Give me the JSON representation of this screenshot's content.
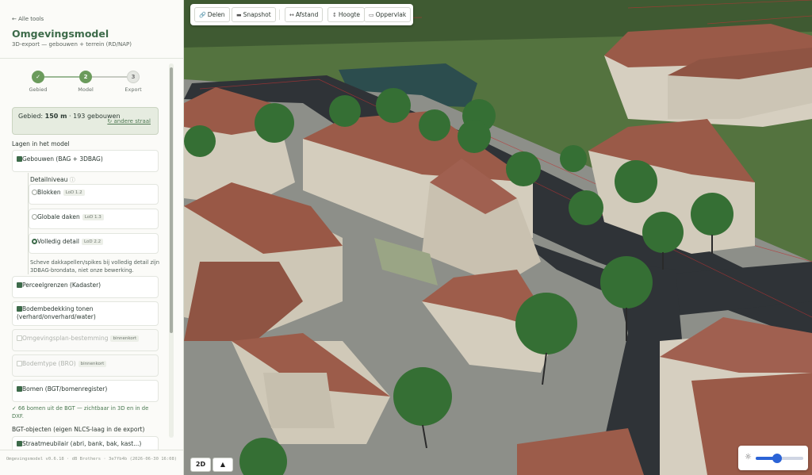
{
  "sidebar": {
    "back_link": "← Alle tools",
    "title": "Omgevingsmodel",
    "subtitle": "3D-export — gebouwen + terrein (RD/NAP)",
    "steps": [
      {
        "number": "✓",
        "label": "Gebied",
        "state": "done"
      },
      {
        "number": "2",
        "label": "Model",
        "state": "active"
      },
      {
        "number": "3",
        "label": "Export",
        "state": "todo"
      }
    ],
    "area": {
      "prefix": "Gebied: ",
      "size": "150 m",
      "count_text": " · 193 gebouwen",
      "change_link": "↻ andere straal"
    },
    "layers_heading": "Lagen in het model",
    "buildings": {
      "label": "Gebouwen (BAG + 3DBAG)",
      "checked": true
    },
    "detail": {
      "label": "Detailniveau",
      "info_icon": "ⓘ",
      "options": [
        {
          "label": "Blokken",
          "tag": "LoD 1.2",
          "selected": false
        },
        {
          "label": "Globale daken",
          "tag": "LoD 1.3",
          "selected": false
        },
        {
          "label": "Volledig detail",
          "tag": "LoD 2.2",
          "selected": true
        }
      ],
      "note": "Scheve dakkapellen/spikes bij volledig detail zijn 3DBAG-brondata, niet onze bewerking."
    },
    "parcels": {
      "label": "Perceelgrenzen (Kadaster)",
      "checked": true
    },
    "landcover": {
      "label": "Bodembedekking tonen (verhard/onverhard/water)",
      "checked": true
    },
    "zoning": {
      "label": "Omgevingsplan-bestemming",
      "tag": "binnenkort",
      "checked": false
    },
    "soil": {
      "label": "Bodemtype (BRO)",
      "tag": "binnenkort",
      "checked": false
    },
    "trees": {
      "label": "Bomen (BGT/bomenregister)",
      "checked": true
    },
    "trees_note": "✓ 66 bomen uit de BGT — zichtbaar in 3D en in de DXF.",
    "bgt_heading": "BGT-objecten (eigen NLCS-laag in de export)",
    "furniture": {
      "label": "Straatmeubilair (abri, bank, bak, kast...)",
      "checked": true
    },
    "footer": "Omgevingsmodel v0.6.18 · dB Brothers · 3e7fb4b (2026-06-30 16:08)"
  },
  "toolbar": {
    "share": {
      "label": "Delen",
      "icon": "🔗"
    },
    "snapshot": {
      "label": "Snapshot",
      "icon": "▬"
    },
    "distance": {
      "label": "Afstand",
      "icon": "↔"
    },
    "height": {
      "label": "Hoogte",
      "icon": "↕"
    },
    "area": {
      "label": "Oppervlak",
      "icon": "▭"
    }
  },
  "view": {
    "mode_2d": "2D",
    "mode_3d_icon": "▲",
    "sun_icon": "☼",
    "sun_level": 0.45
  },
  "colors": {
    "accent": "#3d6b4a",
    "slider": "#2b63d6",
    "roof": "#9a5a48",
    "wall": "#d8d1c2",
    "road": "#2f3337",
    "grass": "#4f6b42",
    "tree": "#356f34"
  }
}
